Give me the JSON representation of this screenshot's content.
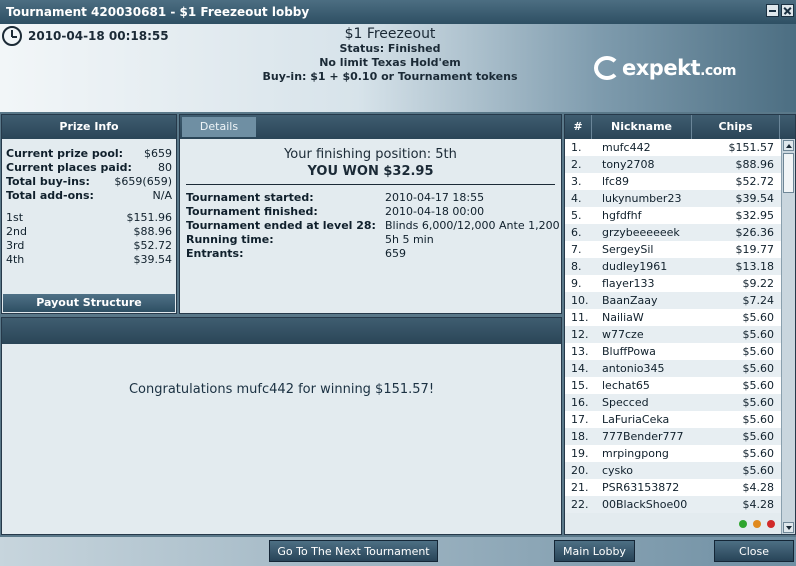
{
  "window": {
    "title": "Tournament 420030681 - $1 Freezeout lobby"
  },
  "header": {
    "datetime": "2010-04-18 00:18:55",
    "tournament_name": "$1 Freezeout",
    "status": "Status: Finished",
    "game": "No limit Texas Hold'em",
    "buyin": "Buy-in: $1 + $0.10 or Tournament tokens",
    "logo_text": "expekt",
    "logo_suffix": ".com"
  },
  "prize_info": {
    "title": "Prize Info",
    "rows": [
      {
        "label": "Current prize pool:",
        "value": "$659"
      },
      {
        "label": "Current places paid:",
        "value": "80"
      },
      {
        "label": "Total buy-ins:",
        "value": "$659(659)"
      },
      {
        "label": "Total add-ons:",
        "value": "N/A"
      }
    ],
    "places": [
      {
        "place": "1st",
        "amount": "$151.96"
      },
      {
        "place": "2nd",
        "amount": "$88.96"
      },
      {
        "place": "3rd",
        "amount": "$52.72"
      },
      {
        "place": "4th",
        "amount": "$39.54"
      }
    ],
    "payout_button": "Payout Structure"
  },
  "details": {
    "tab": "Details",
    "finishing": "Your finishing position:  5th",
    "won": "YOU WON $32.95",
    "rows": [
      {
        "label": "Tournament started:",
        "value": "2010-04-17 18:55"
      },
      {
        "label": "Tournament finished:",
        "value": "2010-04-18 00:00"
      },
      {
        "label": "Tournament ended at level 28:",
        "value": "Blinds 6,000/12,000 Ante 1,200"
      },
      {
        "label": "Running time:",
        "value": "5h 5 min"
      },
      {
        "label": "Entrants:",
        "value": "659"
      }
    ]
  },
  "congrats": "Congratulations mufc442 for winning $151.57!",
  "players": {
    "headers": {
      "rank": "#",
      "nickname": "Nickname",
      "chips": "Chips"
    },
    "rows": [
      {
        "rank": "1.",
        "nickname": "mufc442",
        "chips": "$151.57"
      },
      {
        "rank": "2.",
        "nickname": "tony2708",
        "chips": "$88.96"
      },
      {
        "rank": "3.",
        "nickname": "lfc89",
        "chips": "$52.72"
      },
      {
        "rank": "4.",
        "nickname": "lukynumber23",
        "chips": "$39.54"
      },
      {
        "rank": "5.",
        "nickname": "hgfdfhf",
        "chips": "$32.95"
      },
      {
        "rank": "6.",
        "nickname": "grzybeeeeeek",
        "chips": "$26.36"
      },
      {
        "rank": "7.",
        "nickname": "SergeySil",
        "chips": "$19.77"
      },
      {
        "rank": "8.",
        "nickname": "dudley1961",
        "chips": "$13.18"
      },
      {
        "rank": "9.",
        "nickname": "flayer133",
        "chips": "$9.22"
      },
      {
        "rank": "10.",
        "nickname": "BaanZaay",
        "chips": "$7.24"
      },
      {
        "rank": "11.",
        "nickname": "NailiaW",
        "chips": "$5.60"
      },
      {
        "rank": "12.",
        "nickname": "w77cze",
        "chips": "$5.60"
      },
      {
        "rank": "13.",
        "nickname": "BluffPowa",
        "chips": "$5.60"
      },
      {
        "rank": "14.",
        "nickname": "antonio345",
        "chips": "$5.60"
      },
      {
        "rank": "15.",
        "nickname": "lechat65",
        "chips": "$5.60"
      },
      {
        "rank": "16.",
        "nickname": "Specced",
        "chips": "$5.60"
      },
      {
        "rank": "17.",
        "nickname": "LaFuriaCeka",
        "chips": "$5.60"
      },
      {
        "rank": "18.",
        "nickname": "777Bender777",
        "chips": "$5.60"
      },
      {
        "rank": "19.",
        "nickname": "mrpingpong",
        "chips": "$5.60"
      },
      {
        "rank": "20.",
        "nickname": "cysko",
        "chips": "$5.60"
      },
      {
        "rank": "21.",
        "nickname": "PSR63153872",
        "chips": "$4.28"
      },
      {
        "rank": "22.",
        "nickname": "00BlackShoe00",
        "chips": "$4.28"
      }
    ],
    "status_lights": [
      "#2fa52f",
      "#e08a1e",
      "#d12a2a"
    ]
  },
  "buttons": {
    "next": "Go To The Next Tournament",
    "lobby": "Main Lobby",
    "close": "Close"
  }
}
